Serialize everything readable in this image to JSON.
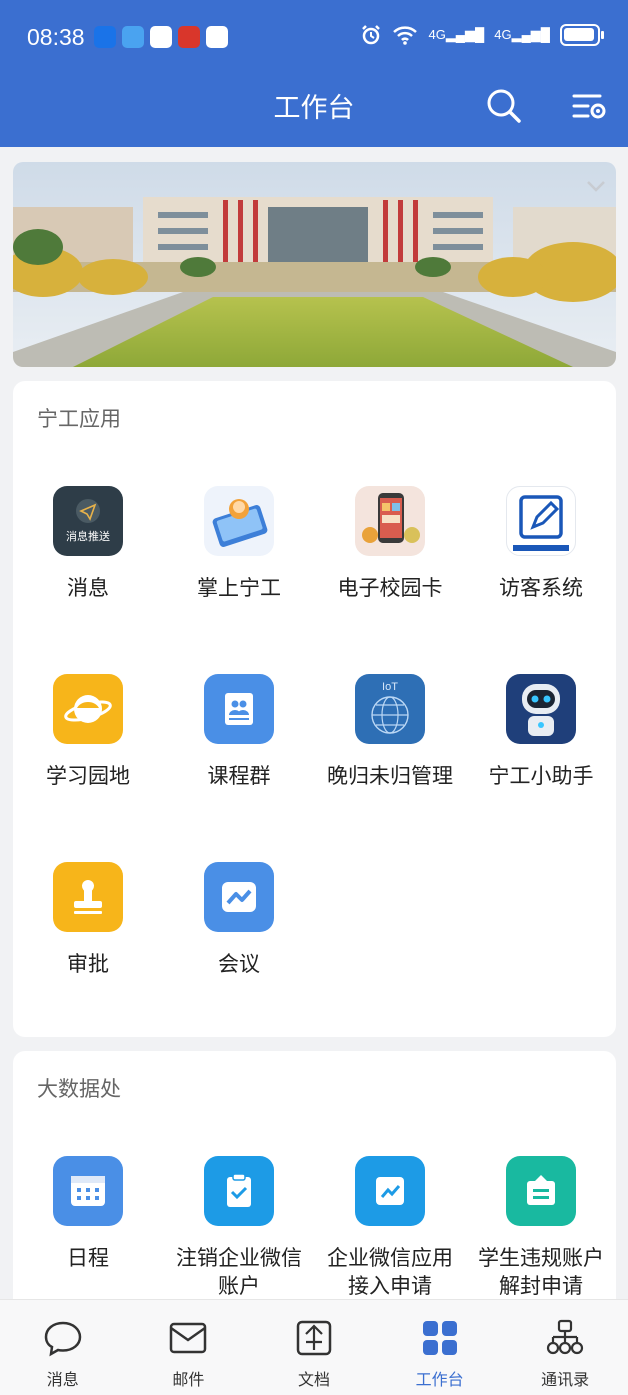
{
  "status_bar": {
    "time": "08:38",
    "net1": "4G",
    "net2": "4G"
  },
  "header": {
    "title": "工作台"
  },
  "sections": [
    {
      "title": "宁工应用",
      "apps": [
        {
          "label": "消息",
          "icon": "message-push-icon",
          "icon_text": "消息推送",
          "color": "#2e3d48"
        },
        {
          "label": "掌上宁工",
          "icon": "mobile-assistant-icon",
          "color": "#eef3fb"
        },
        {
          "label": "电子校园卡",
          "icon": "campus-card-icon",
          "color": "#f4e4dd"
        },
        {
          "label": "访客系统",
          "icon": "visitor-pen-icon",
          "color": "#ffffff"
        },
        {
          "label": "学习园地",
          "icon": "planet-icon",
          "color": "#f7b51a"
        },
        {
          "label": "课程群",
          "icon": "contacts-book-icon",
          "color": "#4a8fe6"
        },
        {
          "label": "晚归未归管理",
          "icon": "iot-globe-icon",
          "icon_text": "IoT",
          "color": "#2e6fb5"
        },
        {
          "label": "宁工小助手",
          "icon": "robot-icon",
          "color": "#1f3f7a"
        },
        {
          "label": "审批",
          "icon": "stamp-icon",
          "color": "#f7b51a"
        },
        {
          "label": "会议",
          "icon": "meeting-icon",
          "color": "#4a8fe6"
        }
      ]
    },
    {
      "title": "大数据处",
      "apps": [
        {
          "label": "日程",
          "icon": "calendar-icon",
          "color": "#4a8fe6"
        },
        {
          "label": "注销企业微信账户",
          "icon": "clipboard-check-icon",
          "color": "#1d9be6"
        },
        {
          "label": "企业微信应用接入申请",
          "icon": "trend-chart-icon",
          "color": "#1d9be6"
        },
        {
          "label": "学生违规账户解封申请",
          "icon": "ticket-icon",
          "color": "#19b9a0"
        }
      ]
    }
  ],
  "bottom_nav": [
    {
      "label": "消息",
      "icon": "chat-bubble-icon"
    },
    {
      "label": "邮件",
      "icon": "mail-icon"
    },
    {
      "label": "文档",
      "icon": "document-icon"
    },
    {
      "label": "工作台",
      "icon": "grid-icon",
      "active": true
    },
    {
      "label": "通讯录",
      "icon": "org-chart-icon"
    }
  ],
  "colors": {
    "primary": "#3b6fd0",
    "background": "#f1f2f4"
  }
}
